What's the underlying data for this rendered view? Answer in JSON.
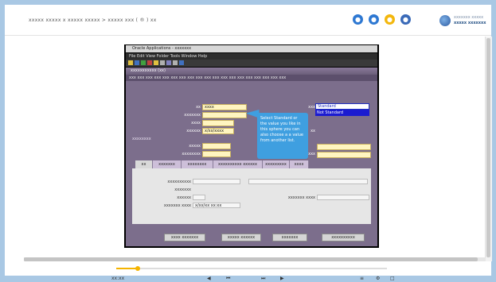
{
  "header": {
    "breadcrumb": "xxxxx xxxxx x xxxxx xxxxx > xxxxx xxx ( ® ) xx",
    "circles": [
      {
        "name": "blue-circle-1",
        "color": "#2e78d2",
        "glyph": "•"
      },
      {
        "name": "blue-circle-2",
        "color": "#2e78d2",
        "glyph": "•"
      },
      {
        "name": "yellow-circle",
        "color": "#f3b70d",
        "glyph": "•"
      },
      {
        "name": "blue-circle-3",
        "color": "#3a6ab8",
        "glyph": "•"
      }
    ],
    "brand_line1": "xxxxxxx xxxxx",
    "brand_line2": "xxxxx xxxxxxx"
  },
  "app": {
    "window_title": "Oracle Applications - xxxxxxx",
    "menu": "File  Edit  View  Folder  Tools  Window  Help",
    "inner_title": "xxxxxxxxxxx  (xx)",
    "subbar": "xxx  xxx  xxx  xxx  xxx  xxx  xxx  xxx  xxx  xxx  xxx  xxx  xxx  xxx  xxx  xxx  xxx  xxx  xxx",
    "fields": {
      "id_value": "xxxx",
      "date_value": "x/xx/xxxx",
      "type_selected": "Standard",
      "type_option": "Not Standard"
    },
    "labels": {
      "id": "xx",
      "parent": "xxxxxxx",
      "line": "xxxx",
      "status": "xxxxxx",
      "section": "xxxxxxxx",
      "amount": "xxxxx",
      "currency": "xxxxxxxx",
      "type": "xxx",
      "xx": "xx",
      "flag": "xxxx"
    },
    "tooltip": "Select Standard or the value you like in this sphere you can also choose a a value from another list.",
    "tabs": [
      "xx",
      "xxxxxxx",
      "xxxxxxxx",
      "xxxxxxxxxx xxxxxx xxxxxx",
      "xxxxxxxxx",
      "xxxx"
    ],
    "tab_panel": {
      "l1": "xxxxxxxxxx",
      "l2": "xxxxxxx",
      "l3": "xxxxxx",
      "l4": "xxxxxxx xxxx",
      "v4": "x/xx/xx xx:xx",
      "l5": "xxxxxxx xxxx"
    },
    "buttons": [
      "xxxx xxxxxxx",
      "xxxxx xxxxxx",
      "xxxxxxx",
      "xxxxxxxxxx"
    ]
  },
  "player": {
    "time": "xx:xx",
    "progress": 0.08,
    "controls": [
      "◀",
      "⏮",
      "⏭",
      "▶",
      "≡",
      "⚙",
      "□"
    ]
  }
}
